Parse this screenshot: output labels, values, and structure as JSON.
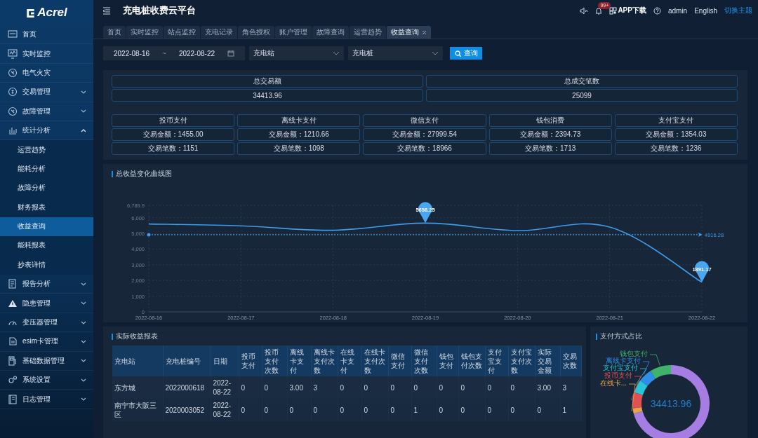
{
  "sidebar": {
    "logo": "Acrel",
    "items": [
      {
        "label": "首页",
        "selected": false
      },
      {
        "label": "实时监控",
        "selected": false
      },
      {
        "label": "电气火灾",
        "selected": false
      },
      {
        "label": "交易管理",
        "selected": false,
        "expanded": false
      },
      {
        "label": "故障管理",
        "selected": false,
        "expanded": false
      },
      {
        "label": "统计分析",
        "selected": false,
        "expanded": true,
        "children": [
          {
            "label": "运营趋势",
            "selected": false
          },
          {
            "label": "能耗分析",
            "selected": false
          },
          {
            "label": "故障分析",
            "selected": false
          },
          {
            "label": "财务报表",
            "selected": false
          },
          {
            "label": "收益查询",
            "selected": true
          },
          {
            "label": "能耗报表",
            "selected": false
          },
          {
            "label": "抄表详情",
            "selected": false
          }
        ]
      },
      {
        "label": "报告分析",
        "selected": false,
        "expanded": false
      },
      {
        "label": "隐患管理",
        "selected": false,
        "expanded": false
      },
      {
        "label": "变压器管理",
        "selected": false,
        "expanded": false
      },
      {
        "label": "esim卡管理",
        "selected": false,
        "expanded": false
      },
      {
        "label": "基础数据管理",
        "selected": false,
        "expanded": false
      },
      {
        "label": "系统设置",
        "selected": false,
        "expanded": false
      },
      {
        "label": "日志管理",
        "selected": false,
        "expanded": false
      }
    ]
  },
  "header": {
    "title": "充电桩收费云平台",
    "notification_badge": "99+",
    "app_download": "APP下载",
    "user": "admin",
    "language": "English",
    "theme_link": "切换主题"
  },
  "tabs": [
    {
      "label": "首页",
      "selected": false
    },
    {
      "label": "实时监控",
      "selected": false
    },
    {
      "label": "站点监控",
      "selected": false
    },
    {
      "label": "充电记录",
      "selected": false
    },
    {
      "label": "角色授权",
      "selected": false
    },
    {
      "label": "账户管理",
      "selected": false
    },
    {
      "label": "故障查询",
      "selected": false
    },
    {
      "label": "运营趋势",
      "selected": false
    },
    {
      "label": "收益查询",
      "selected": true
    }
  ],
  "filter": {
    "start_date": "2022-08-16",
    "separator": "~",
    "end_date": "2022-08-22",
    "station": {
      "placeholder": "充电站"
    },
    "pile": {
      "placeholder": "充电桩"
    },
    "query_button": "查询"
  },
  "summary": {
    "totals": [
      {
        "label": "总交易额",
        "value": "34413.96"
      },
      {
        "label": "总成交笔数",
        "value": "25099"
      }
    ],
    "methods": [
      {
        "name": "投币支付",
        "amount": "交易金额：1455.00",
        "count": "交易笔数：1151"
      },
      {
        "name": "离线卡支付",
        "amount": "交易金额：1210.66",
        "count": "交易笔数：1098"
      },
      {
        "name": "微信支付",
        "amount": "交易金额：27999.54",
        "count": "交易笔数：18966"
      },
      {
        "name": "钱包消费",
        "amount": "交易金额：2394.73",
        "count": "交易笔数：1713"
      },
      {
        "name": "支付宝支付",
        "amount": "交易金额：1354.03",
        "count": "交易笔数：1236"
      }
    ]
  },
  "trend": {
    "title": "总收益变化曲线图",
    "chart_data": {
      "type": "line",
      "categories": [
        "2022-08-16",
        "2022-08-17",
        "2022-08-18",
        "2022-08-19",
        "2022-08-20",
        "2022-08-21",
        "2022-08-22"
      ],
      "series": [
        {
          "color": "#3d9bea",
          "values": [
            5600,
            5480,
            5200,
            5658.25,
            5180,
            5404.54,
            1891.17
          ]
        }
      ],
      "ylim": [
        0,
        6789.9
      ],
      "grid": true,
      "yticks": [
        {
          "value": 0,
          "label": "0"
        },
        {
          "value": 1000,
          "label": "1,000"
        },
        {
          "value": 2000,
          "label": "2,000"
        },
        {
          "value": 3000,
          "label": "3,000"
        },
        {
          "value": 4000,
          "label": "4,000"
        },
        {
          "value": 5000,
          "label": "5,000"
        },
        {
          "value": 6000,
          "label": "6,000"
        },
        {
          "value": 6789.9,
          "label": "6,789.9"
        }
      ],
      "annotations": [
        {
          "text": "5658.25",
          "x": "2022-08-19",
          "y": 5658.25
        },
        {
          "text": "1891.17",
          "x": "2022-08-22",
          "y": 1891.17
        }
      ],
      "ref_lines": [
        {
          "axis": "y",
          "value": 4916.28,
          "label": "4916.28",
          "color": "#3d9bea"
        }
      ]
    }
  },
  "report": {
    "title": "实际收益报表",
    "columns": [
      "充电站",
      "充电桩编号",
      "日期",
      "投币支付",
      "投币支付次数",
      "离线卡支付",
      "离线卡支付次数",
      "在线卡支付",
      "在线卡支付次数",
      "微信支付",
      "微信支付次数",
      "钱包支付",
      "钱包支付次数",
      "支付宝支付",
      "支付宝支付次数",
      "实际交易金额",
      "交易次数"
    ],
    "rows": [
      [
        "东方城",
        "2022000618",
        "2022-08-22",
        "0",
        "0",
        "3.00",
        "3",
        "0",
        "0",
        "0",
        "0",
        "0",
        "0",
        "0",
        "0",
        "3.00",
        "3"
      ],
      [
        "南宁市大阪三区",
        "2020003052",
        "2022-08-22",
        "0",
        "0",
        "0",
        "0",
        "0",
        "0",
        "0",
        "1",
        "0",
        "0",
        "0",
        "0",
        "0",
        "1"
      ]
    ]
  },
  "share": {
    "title": "支付方式占比",
    "center_value": "34413.96",
    "labels": [
      {
        "text": "钱包支付",
        "color": "#3fb36b"
      },
      {
        "text": "离线卡支付",
        "color": "#2f8fe8"
      },
      {
        "text": "支付宝支付",
        "color": "#27c6d8"
      },
      {
        "text": "投币支付",
        "color": "#e05252"
      },
      {
        "text": "在线卡...",
        "color": "#e8a24c"
      }
    ]
  }
}
